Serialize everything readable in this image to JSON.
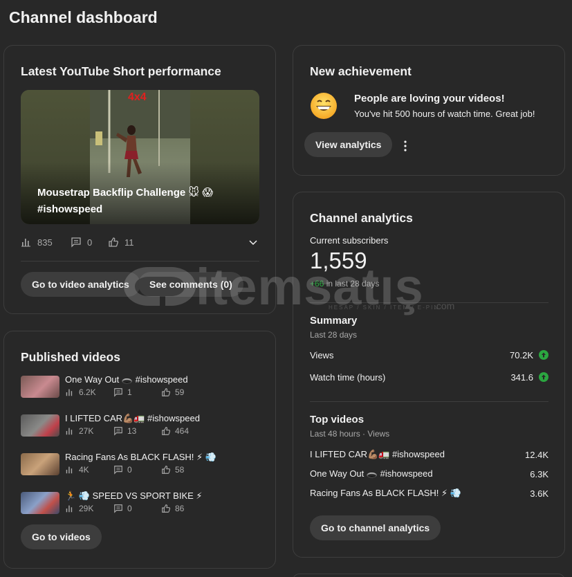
{
  "page": {
    "title": "Channel dashboard"
  },
  "short": {
    "heading": "Latest YouTube Short performance",
    "thumb_badge": "4x4",
    "video_title": "Mousetrap Backflip Challenge 🐭 😱 #ishowspeed",
    "views": "835",
    "comments": "0",
    "likes": "11",
    "analytics_btn": "Go to video analytics",
    "comments_btn": "See comments (0)"
  },
  "achievement": {
    "heading": "New achievement",
    "icon": "grinning-face-icon",
    "title": "People are loving your videos!",
    "subtitle": "You've hit 500 hours of watch time. Great job!",
    "button": "View analytics"
  },
  "analytics": {
    "heading": "Channel analytics",
    "subs_label": "Current subscribers",
    "subs_value": "1,559",
    "subs_delta": "+66",
    "subs_delta_suffix": " in last 28 days",
    "summary_title": "Summary",
    "summary_sub": "Last 28 days",
    "metrics": [
      {
        "label": "Views",
        "value": "70.2K",
        "trend": "up"
      },
      {
        "label": "Watch time (hours)",
        "value": "341.6",
        "trend": "up"
      }
    ],
    "top_title": "Top videos",
    "top_sub": "Last 48 hours · Views",
    "top_videos": [
      {
        "title": "I LIFTED CAR💪🏽🚛 #ishowspeed",
        "views": "12.4K"
      },
      {
        "title": "One Way Out 🕳️ #ishowspeed",
        "views": "6.3K"
      },
      {
        "title": "Racing Fans As BLACK FLASH! ⚡ 💨",
        "views": "3.6K"
      }
    ],
    "button": "Go to channel analytics",
    "trend_color": "#2ba640"
  },
  "published": {
    "heading": "Published videos",
    "videos": [
      {
        "title": "One Way Out 🕳️ #ishowspeed",
        "views": "6.2K",
        "comments": "1",
        "likes": "59"
      },
      {
        "title": "I LIFTED CAR💪🏽🚛 #ishowspeed",
        "views": "27K",
        "comments": "13",
        "likes": "464"
      },
      {
        "title": "Racing Fans As BLACK FLASH! ⚡ 💨",
        "views": "4K",
        "comments": "0",
        "likes": "58"
      },
      {
        "title": "🏃 💨 SPEED VS SPORT BIKE ⚡",
        "views": "29K",
        "comments": "0",
        "likes": "86"
      }
    ],
    "button": "Go to videos"
  },
  "watermark": {
    "text": "itemsatış",
    "small": "HESAP / SKIN / ITEM / E-PIN",
    "domain": ".com"
  }
}
